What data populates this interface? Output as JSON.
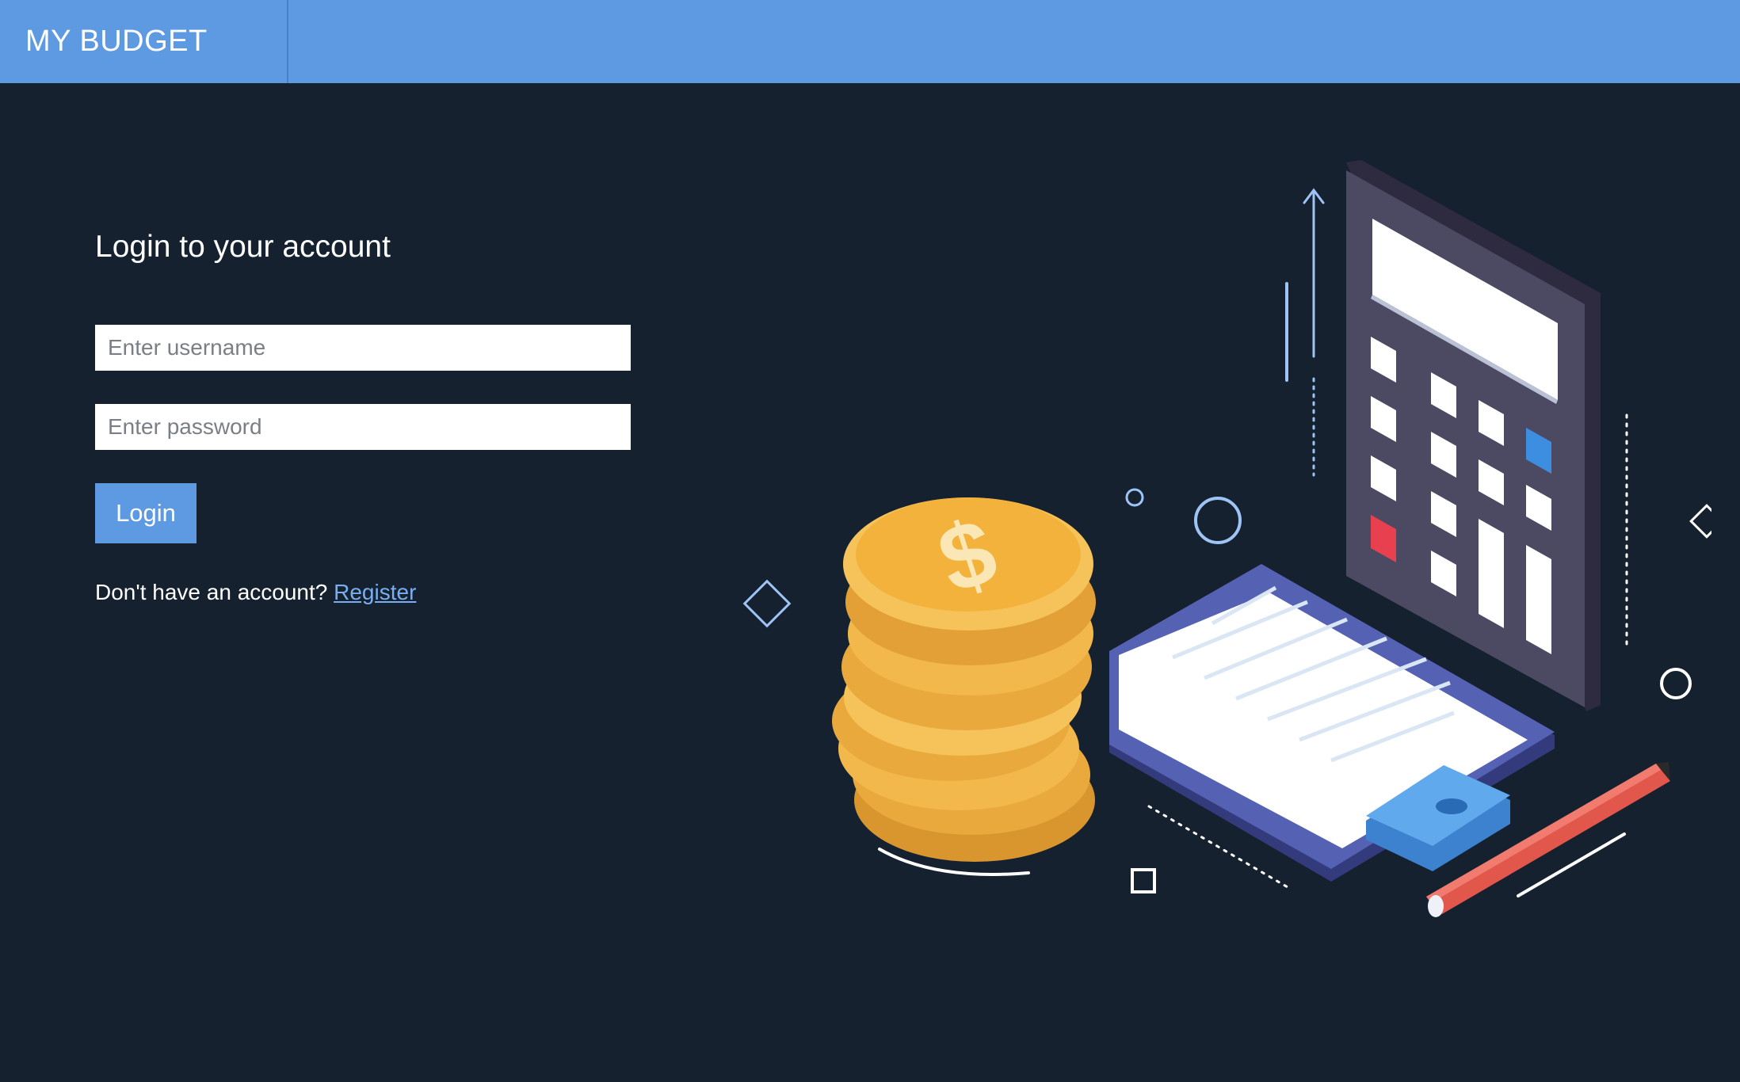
{
  "header": {
    "brand": "MY BUDGET"
  },
  "login": {
    "title": "Login to your account",
    "username_placeholder": "Enter username",
    "password_placeholder": "Enter password",
    "login_label": "Login",
    "register_prompt": "Don't have an account?",
    "register_label": "Register"
  },
  "illustration": {
    "icons": [
      "calculator-icon",
      "coin-stack-icon",
      "clipboard-icon",
      "pencil-icon"
    ],
    "colors": {
      "accent": "#5e9ae1",
      "background": "#15212f",
      "coin": "#f2b84b",
      "calculator": "#4c4a63",
      "clipboard": "#5562b4",
      "pencil": "#e2574c"
    }
  }
}
